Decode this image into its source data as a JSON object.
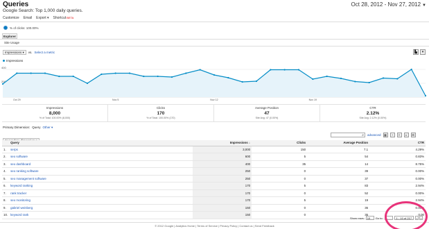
{
  "header": {
    "title": "Queries",
    "subtitle": "Google Search: Top 1,000 daily queries.",
    "date_range": "Oct 28, 2012 - Nov 27, 2012"
  },
  "toolbar": {
    "customize": "Customize",
    "email": "Email",
    "export": "Export ▾",
    "shortcut": "Shortcut",
    "beta": "BETA"
  },
  "summary": {
    "clicks_pct": "% of clicks: 100.00%"
  },
  "tabs": {
    "explorer": "Explorer",
    "site_usage": "Site Usage"
  },
  "metric_selector": {
    "primary": "Impressions",
    "vs": "vs.",
    "select_metric": "Select a metric"
  },
  "legend": {
    "label": "Impressions"
  },
  "chart_data": {
    "type": "area",
    "ytick_labels": [
      "400",
      "200"
    ],
    "x_tick_labels": [
      "Oct 29",
      "Nov 5",
      "Nov 12",
      "Nov 19"
    ],
    "x": [
      "Oct 28",
      "Oct 29",
      "Oct 30",
      "Oct 31",
      "Nov 1",
      "Nov 2",
      "Nov 3",
      "Nov 4",
      "Nov 5",
      "Nov 6",
      "Nov 7",
      "Nov 8",
      "Nov 9",
      "Nov 10",
      "Nov 11",
      "Nov 12",
      "Nov 13",
      "Nov 14",
      "Nov 15",
      "Nov 16",
      "Nov 17",
      "Nov 18",
      "Nov 19",
      "Nov 20",
      "Nov 21",
      "Nov 22",
      "Nov 23",
      "Nov 24",
      "Nov 25",
      "Nov 26",
      "Nov 27"
    ],
    "series": [
      {
        "name": "Impressions",
        "values": [
          190,
          345,
          345,
          345,
          300,
          300,
          200,
          330,
          345,
          345,
          300,
          300,
          290,
          345,
          395,
          320,
          280,
          220,
          230,
          395,
          395,
          395,
          260,
          300,
          270,
          225,
          210,
          275,
          265,
          400,
          20
        ]
      }
    ],
    "ylim": [
      0,
      480
    ],
    "grid": true,
    "colors": {
      "line": "#058dc7",
      "fill": "#e6f3fa"
    }
  },
  "scorecards": [
    {
      "label": "Impressions",
      "value": "8,000",
      "sub": "% of Total: 100.00% (8,000)"
    },
    {
      "label": "Clicks",
      "value": "170",
      "sub": "% of Total: 100.00% (170)"
    },
    {
      "label": "Average Position",
      "value": "47",
      "sub": "Site Avg: 47 (0.00%)"
    },
    {
      "label": "CTR",
      "value": "2.12%",
      "sub": "Site Avg: 2.12% (0.00%)"
    }
  ],
  "dimension": {
    "label": "Primary Dimension:",
    "value": "Query",
    "other": "Other ▾"
  },
  "secondary_dimension": "Secondary dimension ▾",
  "table_tools": {
    "advanced": "advanced"
  },
  "table": {
    "headers": [
      "Query",
      "Impressions",
      "Clicks",
      "Average Position",
      "CTR"
    ],
    "rows": [
      {
        "idx": "1.",
        "query": "serps",
        "impressions": "3,000",
        "clicks": "150",
        "position": "7.1",
        "ctr": "4.29%"
      },
      {
        "idx": "2.",
        "query": "seo software",
        "impressions": "600",
        "clicks": "5",
        "position": "54",
        "ctr": "0.83%"
      },
      {
        "idx": "3.",
        "query": "seo dashboard",
        "impressions": "400",
        "clicks": "35",
        "position": "14",
        "ctr": "8.75%"
      },
      {
        "idx": "4.",
        "query": "seo ranking software",
        "impressions": "250",
        "clicks": "0",
        "position": "39",
        "ctr": "0.00%"
      },
      {
        "idx": "5.",
        "query": "seo management software",
        "impressions": "250",
        "clicks": "0",
        "position": "37",
        "ctr": "0.00%"
      },
      {
        "idx": "6.",
        "query": "keyword ranking",
        "impressions": "170",
        "clicks": "5",
        "position": "83",
        "ctr": "2.94%"
      },
      {
        "idx": "7.",
        "query": "rank tracker",
        "impressions": "170",
        "clicks": "0",
        "position": "52",
        "ctr": "0.00%"
      },
      {
        "idx": "8.",
        "query": "seo monitoring",
        "impressions": "170",
        "clicks": "5",
        "position": "19",
        "ctr": "2.94%"
      },
      {
        "idx": "9.",
        "query": "gabriel weinberg",
        "impressions": "150",
        "clicks": "0",
        "position": "36",
        "ctr": "0.00%"
      },
      {
        "idx": "10.",
        "query": "keyword rank",
        "impressions": "150",
        "clicks": "0",
        "position": "35",
        "ctr": "0.00"
      }
    ]
  },
  "pagination": {
    "show_rows_label": "Show rows:",
    "rows_value": "10",
    "goto_label": "Go to:",
    "goto_value": "1",
    "range": "1 - 10 of 217"
  },
  "footer": {
    "copyright": "© 2012 Google | Analytics Home | Terms of Service | Privacy Policy | Contact us | Send Feedback"
  },
  "annotation": {
    "color": "#e8337a"
  },
  "icons": {
    "chart_type": "line-chart-icon",
    "chart_options": "chart-options-icon"
  }
}
